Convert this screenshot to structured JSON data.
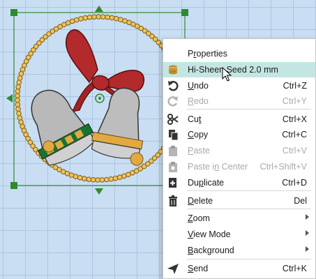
{
  "menu": {
    "items": [
      {
        "id": "properties",
        "pre": "P",
        "u": "r",
        "post": "operties",
        "shortcut": "",
        "enabled": true,
        "highlight": false,
        "icon": "",
        "submenu": false
      },
      {
        "id": "hisheen",
        "pre": "",
        "u": "",
        "post": "Hi-Sheen Seed 2.0 mm",
        "shortcut": "",
        "enabled": true,
        "highlight": true,
        "icon": "thread-spool-icon",
        "submenu": false
      },
      {
        "id": "undo",
        "pre": "",
        "u": "U",
        "post": "ndo",
        "shortcut": "Ctrl+Z",
        "enabled": true,
        "highlight": false,
        "icon": "undo-icon",
        "submenu": false
      },
      {
        "id": "redo",
        "pre": "",
        "u": "R",
        "post": "edo",
        "shortcut": "Ctrl+Y",
        "enabled": false,
        "highlight": false,
        "icon": "redo-icon",
        "submenu": false
      },
      {
        "id": "cut",
        "pre": "Cu",
        "u": "t",
        "post": "",
        "shortcut": "Ctrl+X",
        "enabled": true,
        "highlight": false,
        "icon": "scissors-icon",
        "submenu": false
      },
      {
        "id": "copy",
        "pre": "",
        "u": "C",
        "post": "opy",
        "shortcut": "Ctrl+C",
        "enabled": true,
        "highlight": false,
        "icon": "copy-icon",
        "submenu": false
      },
      {
        "id": "paste",
        "pre": "",
        "u": "P",
        "post": "aste",
        "shortcut": "Ctrl+V",
        "enabled": false,
        "highlight": false,
        "icon": "paste-icon",
        "submenu": false
      },
      {
        "id": "paste_center",
        "pre": "Paste i",
        "u": "n",
        "post": " Center",
        "shortcut": "Ctrl+Shift+V",
        "enabled": false,
        "highlight": false,
        "icon": "paste-center-icon",
        "submenu": false
      },
      {
        "id": "duplicate",
        "pre": "Du",
        "u": "p",
        "post": "licate",
        "shortcut": "Ctrl+D",
        "enabled": true,
        "highlight": false,
        "icon": "duplicate-icon",
        "submenu": false
      },
      {
        "id": "delete",
        "pre": "",
        "u": "D",
        "post": "elete",
        "shortcut": "Del",
        "enabled": true,
        "highlight": false,
        "icon": "trash-icon",
        "submenu": false
      },
      {
        "id": "zoom",
        "pre": "",
        "u": "Z",
        "post": "oom",
        "shortcut": "",
        "enabled": true,
        "highlight": false,
        "icon": "",
        "submenu": true
      },
      {
        "id": "viewmode",
        "pre": "",
        "u": "V",
        "post": "iew Mode",
        "shortcut": "",
        "enabled": true,
        "highlight": false,
        "icon": "",
        "submenu": true
      },
      {
        "id": "background",
        "pre": "",
        "u": "B",
        "post": "ackground",
        "shortcut": "",
        "enabled": true,
        "highlight": false,
        "icon": "",
        "submenu": true
      },
      {
        "id": "send",
        "pre": "",
        "u": "S",
        "post": "end",
        "shortcut": "Ctrl+K",
        "enabled": true,
        "highlight": false,
        "icon": "send-icon",
        "submenu": false
      }
    ]
  },
  "colors": {
    "canvas": "#c9def2",
    "grid": "#aac6e4",
    "handle": "#2f8a2f",
    "bow": "#b22a2c",
    "bell": "#b9b9b9",
    "bell_band": "#157530",
    "bead": "#e2a941",
    "highlight": "#c4e6e2"
  }
}
